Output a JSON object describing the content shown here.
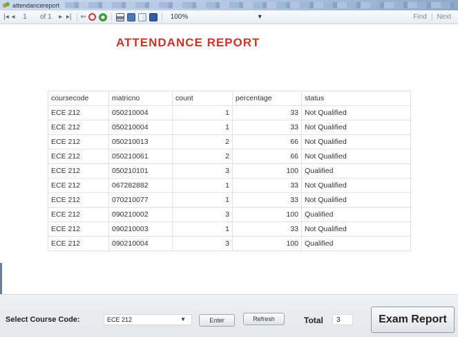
{
  "window": {
    "title": "attendancereport"
  },
  "toolbar": {
    "first_icon": "|◂",
    "prev_icon": "◂",
    "page_current": "1",
    "page_of": "of 1",
    "next_icon": "▸",
    "last_icon": "▸|",
    "back_icon": "⇐",
    "zoom_value": "100%",
    "zoom_arrow": "▾",
    "find_label": "Find",
    "next_label": "Next",
    "pipe": "|"
  },
  "report": {
    "title": "ATTENDANCE REPORT",
    "columns": [
      "coursecode",
      "matricno",
      "count",
      "percentage",
      "status"
    ],
    "rows": [
      [
        "ECE 212",
        "050210004",
        "1",
        "33",
        "Not Qualified"
      ],
      [
        "ECE 212",
        "050210004",
        "1",
        "33",
        "Not Qualified"
      ],
      [
        "ECE 212",
        "050210013",
        "2",
        "66",
        "Not Qualified"
      ],
      [
        "ECE 212",
        "050210061",
        "2",
        "66",
        "Not Qualified"
      ],
      [
        "ECE 212",
        "050210101",
        "3",
        "100",
        "Qualified"
      ],
      [
        "ECE 212",
        "067282882",
        "1",
        "33",
        "Not Qualified"
      ],
      [
        "ECE 212",
        "070210077",
        "1",
        "33",
        "Not Qualified"
      ],
      [
        "ECE 212",
        "090210002",
        "3",
        "100",
        "Qualified"
      ],
      [
        "ECE 212",
        "090210003",
        "1",
        "33",
        "Not Qualified"
      ],
      [
        "ECE 212",
        "090210004",
        "3",
        "100",
        "Qualified"
      ]
    ]
  },
  "form": {
    "course_label": "Select Course Code:",
    "course_value": "ECE 212",
    "combo_arrow": "▼",
    "enter_label": "Enter",
    "refresh_label": "Refresh",
    "total_label": "Total",
    "total_value": "3",
    "exam_report_label": "Exam Report"
  },
  "colors": {
    "title_red": "#d23027",
    "toolbar_bg": "#e9eef5",
    "panel_bg": "#e4e7eb"
  },
  "icons": [
    "first-page-icon",
    "prev-page-icon",
    "next-page-icon",
    "last-page-icon",
    "back-icon",
    "stop-icon",
    "refresh-icon",
    "print-icon",
    "print-layout-icon",
    "page-setup-icon",
    "export-icon",
    "app-icon"
  ]
}
